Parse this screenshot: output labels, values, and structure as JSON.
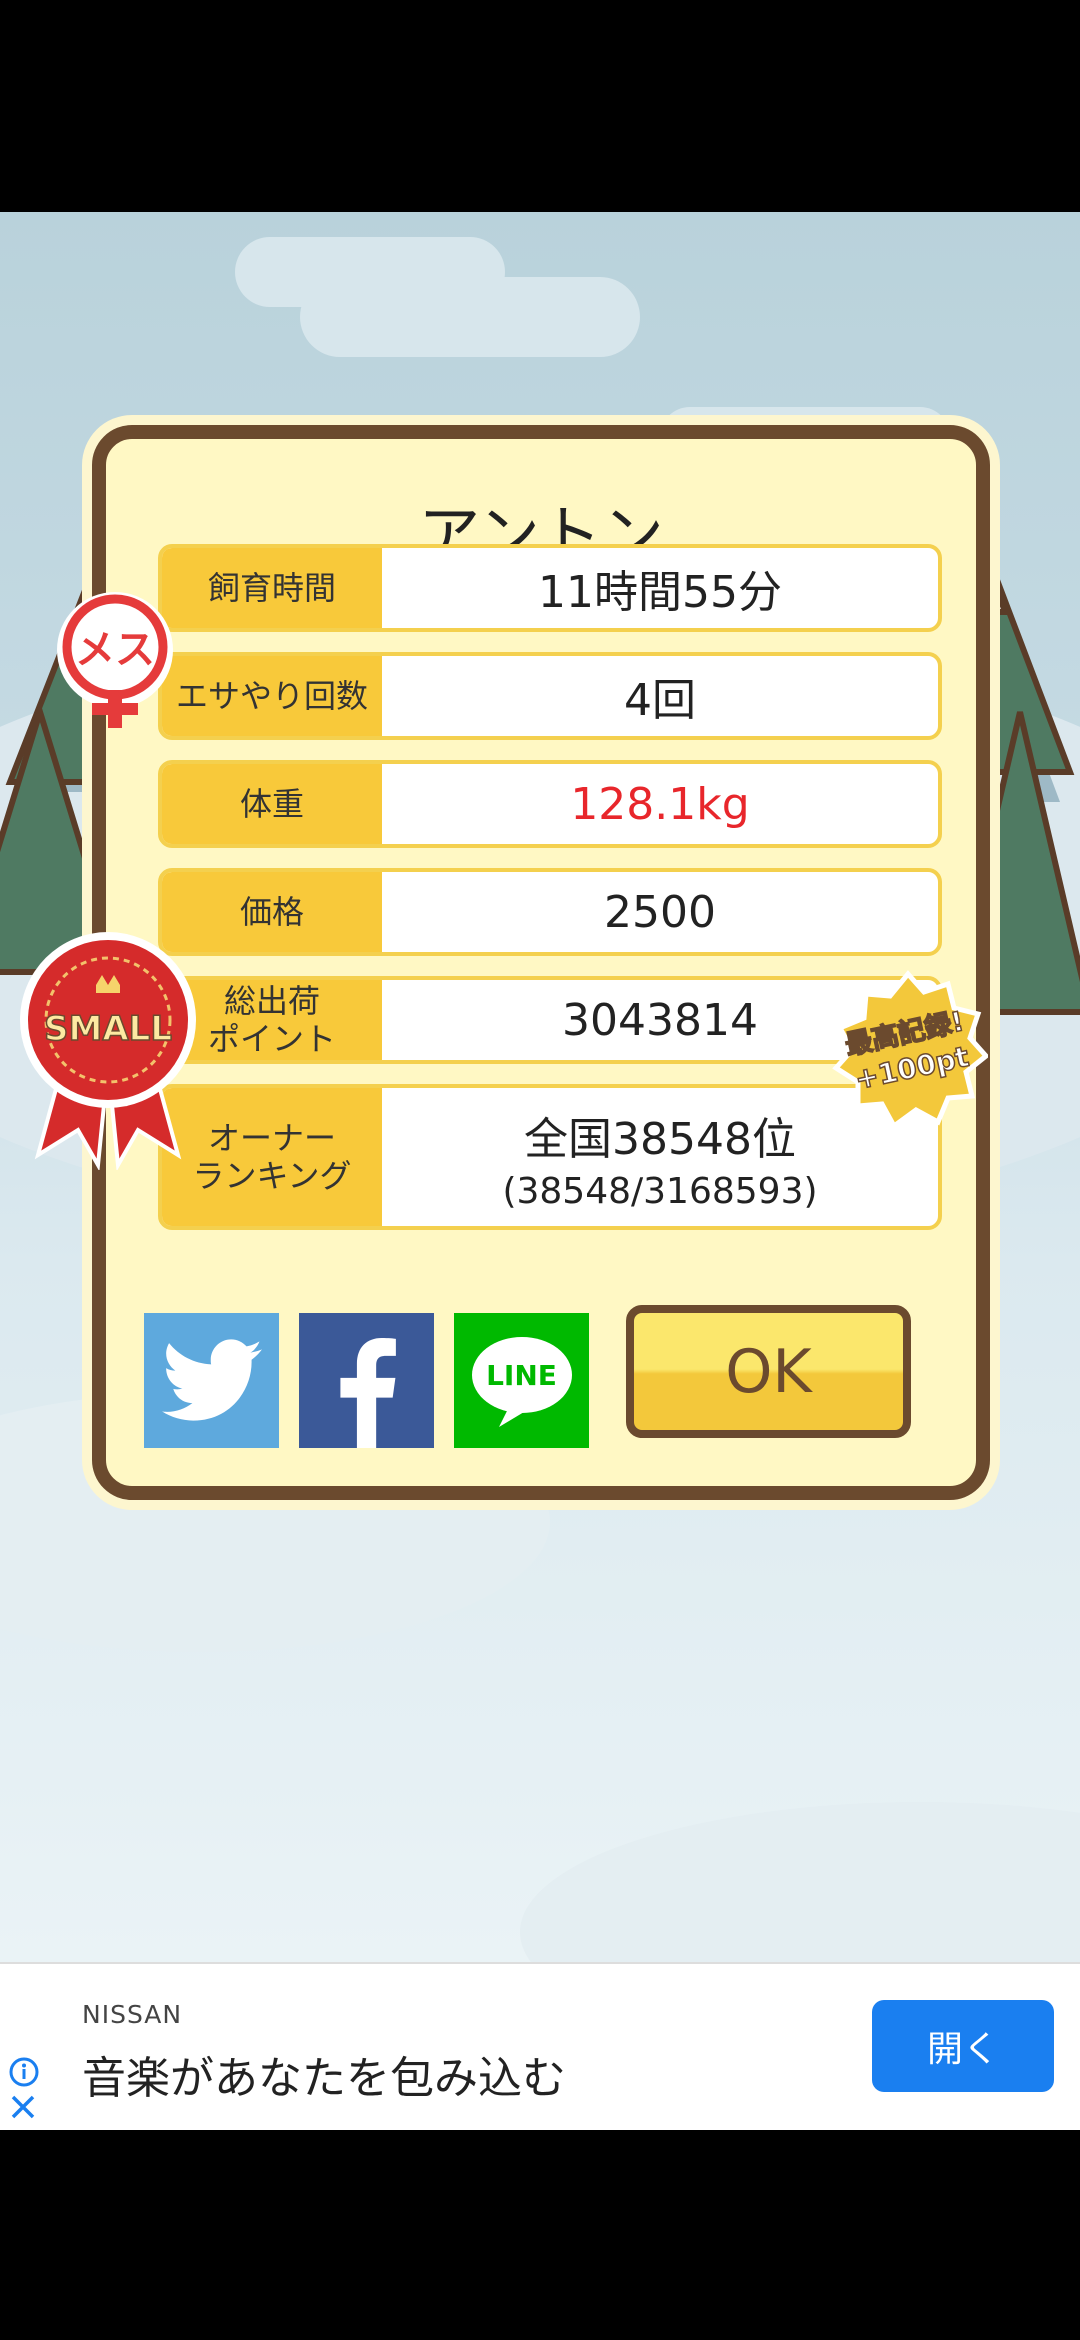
{
  "pet": {
    "name": "アントン",
    "gender_badge": "メス",
    "size_badge": "SMALL",
    "record_badge": "最高記録!\n+100pt"
  },
  "stats": [
    {
      "label": "飼育時間",
      "value": "11時間55分",
      "color": "#222222"
    },
    {
      "label": "エサやり回数",
      "value": "4回",
      "color": "#222222"
    },
    {
      "label": "体重",
      "value": "128.1kg",
      "color": "#e8262b"
    },
    {
      "label": "価格",
      "value": "2500",
      "color": "#222222"
    },
    {
      "label": "総出荷\nポイント",
      "value": "3043814",
      "color": "#222222"
    }
  ],
  "ranking": {
    "label": "オーナー\nランキング",
    "value": "全国38548位",
    "detail": "(38548/3168593)"
  },
  "share": {
    "twitter_icon": "twitter-icon",
    "facebook_icon": "facebook-icon",
    "line_label": "LINE"
  },
  "buttons": {
    "ok": "OK"
  },
  "ad": {
    "brand": "NISSAN",
    "text": "音楽があなたを包み込む",
    "cta": "開く"
  },
  "colors": {
    "dialog_bg": "#fff8c4",
    "dialog_border": "#6b4a2e",
    "label_bg": "#f8c93a",
    "twitter": "#5ea9dd",
    "facebook": "#3b5998",
    "line": "#00b900",
    "ad_cta": "#1a7ff0"
  }
}
